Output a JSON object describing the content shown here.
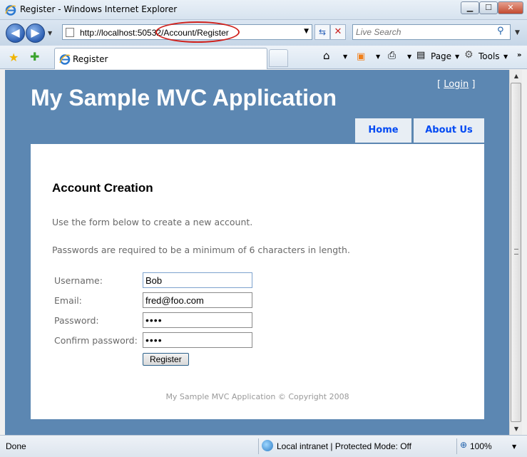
{
  "window": {
    "title": "Register - Windows Internet Explorer",
    "minimize_icon": "minimize-icon",
    "maximize_icon": "maximize-icon",
    "close_icon": "close-icon"
  },
  "navbar": {
    "url": "http://localhost:50532/Account/Register",
    "search_placeholder": "Live Search"
  },
  "toolbar": {
    "tab_label": "Register",
    "page_label": "Page",
    "tools_label": "Tools"
  },
  "site": {
    "title": "My Sample MVC Application",
    "login_open": "[ ",
    "login_label": "Login",
    "login_close": " ]",
    "menu": [
      {
        "label": "Home"
      },
      {
        "label": "About Us"
      }
    ]
  },
  "page": {
    "heading": "Account Creation",
    "intro": "Use the form below to create a new account.",
    "password_note": "Passwords are required to be a minimum of 6 characters in length.",
    "form": {
      "fields": [
        {
          "label": "Username:",
          "value": "Bob",
          "type": "text"
        },
        {
          "label": "Email:",
          "value": "fred@foo.com",
          "type": "text"
        },
        {
          "label": "Password:",
          "value": "bobb",
          "type": "password"
        },
        {
          "label": "Confirm password:",
          "value": "bobb",
          "type": "password"
        }
      ],
      "submit_label": "Register"
    },
    "footer": "My Sample MVC Application © Copyright 2008"
  },
  "status": {
    "text": "Done",
    "zone": "Local intranet | Protected Mode: Off",
    "zoom": "100%"
  },
  "colors": {
    "page_background": "#5c87b2",
    "menu_tab_text": "#034af3",
    "annotation_circle": "#d0211c"
  }
}
